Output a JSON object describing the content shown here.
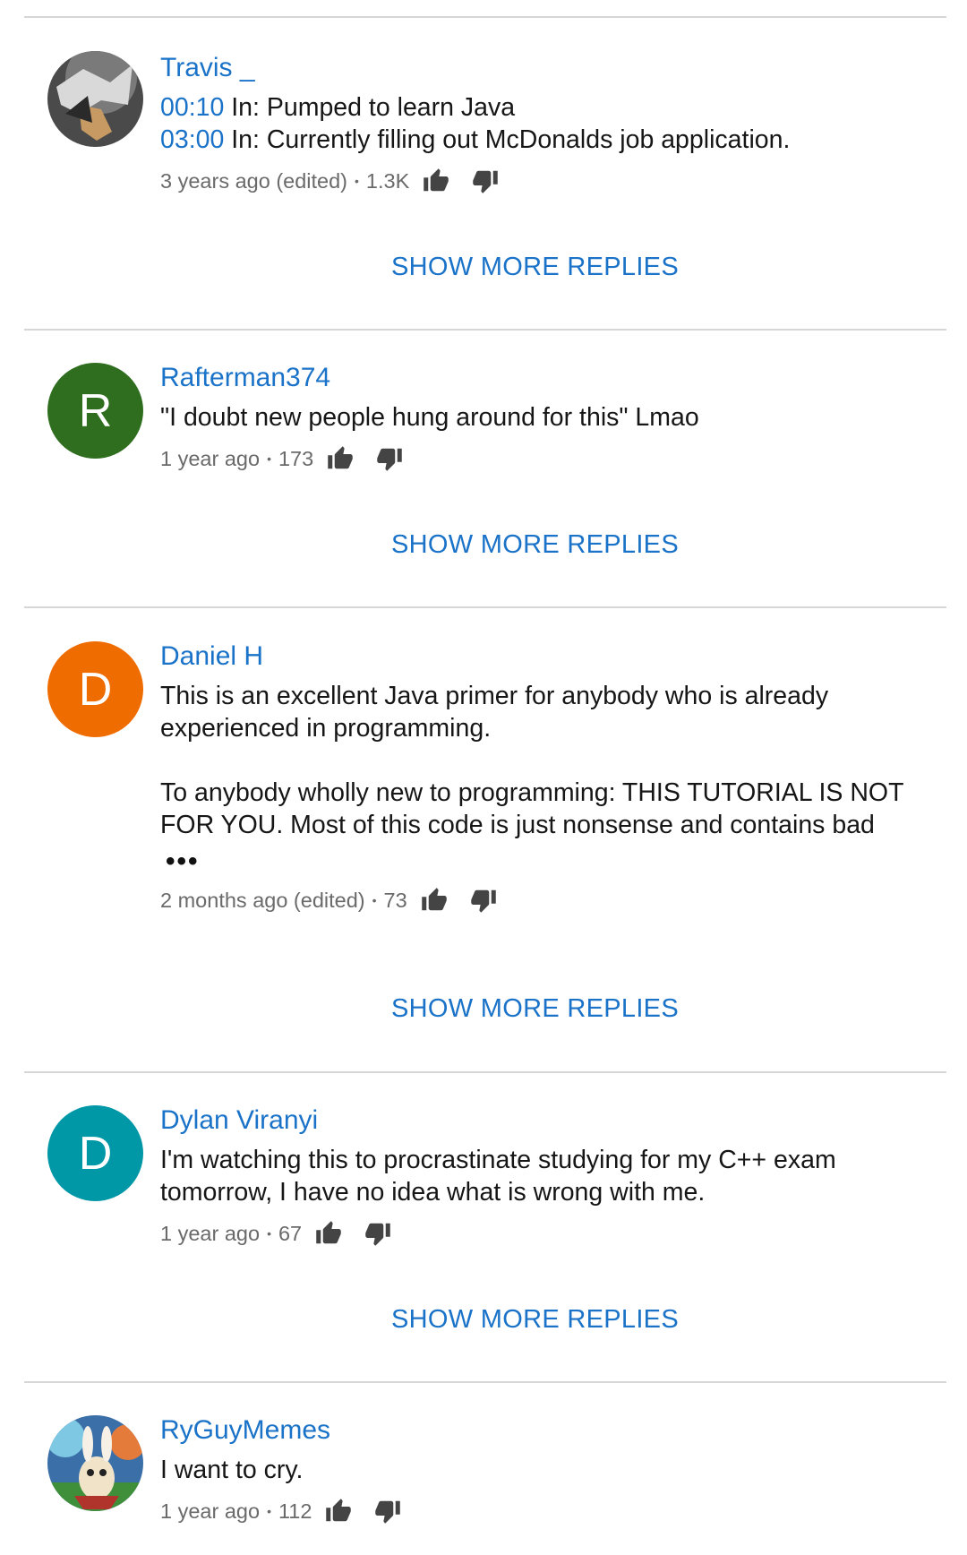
{
  "comments": [
    {
      "author": "Travis _",
      "lines": [
        {
          "ts": "00:10",
          "text": " In: Pumped to learn Java"
        },
        {
          "ts": "03:00",
          "text": " In: Currently filling out McDonalds job application."
        }
      ],
      "time": "3 years ago (edited)",
      "likes": "1.3K",
      "show_more": "SHOW MORE REPLIES"
    },
    {
      "author": "Rafterman374",
      "avatar_letter": "R",
      "avatar_color": "#2f6e1f",
      "text": "\"I doubt new people hung around for this\" Lmao",
      "time": "1 year ago",
      "likes": "173",
      "show_more": "SHOW MORE REPLIES"
    },
    {
      "author": "Daniel H",
      "avatar_letter": "D",
      "avatar_color": "#ef6c00",
      "text": "This is an excellent Java primer for anybody who is already experienced in programming.\n\nTo anybody wholly new to programming: THIS TUTORIAL IS NOT FOR YOU. Most of this code is just nonsense and contains bad",
      "ellipsis": "•••",
      "time": "2 months ago (edited)",
      "likes": "73",
      "show_more": "SHOW MORE REPLIES"
    },
    {
      "author": "Dylan Viranyi",
      "avatar_letter": "D",
      "avatar_color": "#0097a7",
      "text": "I'm watching this to procrastinate studying for my C++ exam tomorrow, I have no idea what is wrong with me.",
      "time": "1 year ago",
      "likes": "67",
      "show_more": "SHOW MORE REPLIES"
    },
    {
      "author": "RyGuyMemes",
      "text": "I want to cry.",
      "time": "1 year ago",
      "likes": "112"
    }
  ],
  "meta_separator": "•",
  "icons": {
    "like": "thumb-up-icon",
    "dislike": "thumb-down-icon"
  },
  "colors": {
    "accent": "#1a73c8",
    "meta_text": "#6a6a6a",
    "divider": "#d6d6d6"
  }
}
